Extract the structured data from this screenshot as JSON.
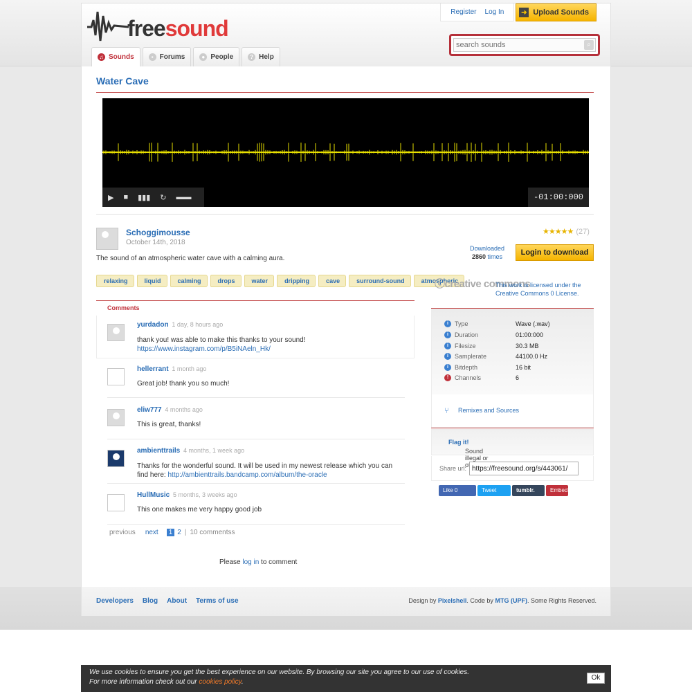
{
  "header": {
    "brand": {
      "free": "free",
      "sound": "sound"
    },
    "register": "Register",
    "login": "Log In",
    "upload": "Upload Sounds",
    "search_placeholder": "search sounds",
    "tabs": [
      {
        "label": "Sounds",
        "icon": "headphones-icon"
      },
      {
        "label": "Forums",
        "icon": "chat-icon"
      },
      {
        "label": "People",
        "icon": "people-icon"
      },
      {
        "label": "Help",
        "icon": "help-icon"
      }
    ]
  },
  "sound": {
    "title": "Water Cave",
    "timer": "-01:00:000",
    "user": "Schoggimousse",
    "date": "October 14th, 2018",
    "description": "The sound of an atmospheric water cave with a calming aura.",
    "rating_count": "(27)",
    "rating_stars": 5,
    "downloaded_label": "Downloaded",
    "downloaded_count": "2860",
    "downloaded_suffix": "times",
    "download_button": "Login to download",
    "tags": [
      "relaxing",
      "liquid",
      "calming",
      "drops",
      "water",
      "dripping",
      "cave",
      "surround-sound",
      "atmospheric"
    ],
    "license_logo": "creative commons",
    "license_line1": "This work is licensed under the",
    "license_line2": "Creative Commons 0 License."
  },
  "comments": {
    "heading": "Comments",
    "items": [
      {
        "user": "yurdadon",
        "ago": "1 day, 8 hours ago",
        "text": "thank you! was able to make this thanks to your sound!",
        "link": "https://www.instagram.com/p/B5iNAeln_Hk/"
      },
      {
        "user": "hellerrant",
        "ago": "1 month ago",
        "text": "Great job! thank you so much!",
        "link": ""
      },
      {
        "user": "eliw777",
        "ago": "4 months ago",
        "text": "This is great, thanks!",
        "link": ""
      },
      {
        "user": "ambienttrails",
        "ago": "4 months, 1 week ago",
        "text": "Thanks for the wonderful sound. It will be used in my newest release which you can",
        "text2": "find here:",
        "link": "http://ambienttrails.bandcamp.com/album/the-oracle"
      },
      {
        "user": "HullMusic",
        "ago": "5 months, 3 weeks ago",
        "text": "This one makes me very happy good job",
        "link": ""
      }
    ],
    "pager": {
      "previous": "previous",
      "next": "next",
      "current": "1",
      "page2": "2",
      "separator": "|",
      "total": "10 commentss"
    },
    "login_note": {
      "pre": "Please",
      "link": "log in",
      "post": "to comment"
    }
  },
  "info": [
    {
      "key": "Type",
      "value": "Wave (.wav)"
    },
    {
      "key": "Duration",
      "value": "01:00:000"
    },
    {
      "key": "Filesize",
      "value": "30.3 MB"
    },
    {
      "key": "Samplerate",
      "value": "44100.0 Hz"
    },
    {
      "key": "Bitdepth",
      "value": "16 bit"
    },
    {
      "key": "Channels",
      "value": "6"
    }
  ],
  "sidebar": {
    "remixes": "Remixes and Sources",
    "flag_text": "Sound illegal or offensive?",
    "flag_link": "Flag it!",
    "share_label": "Share url:",
    "share_url": "https://freesound.org/s/443061/",
    "social": {
      "like": "Like 0",
      "tweet": "Tweet",
      "tumblr": "tumblr.",
      "embed": "Embed"
    }
  },
  "footer": {
    "links": [
      "Developers",
      "Blog",
      "About",
      "Terms of use"
    ],
    "credits_pre": "Design by",
    "credits_design": "Pixelshell",
    "credits_mid": ". Code by",
    "credits_code": "MTG (UPF)",
    "credits_post": ". Some Rights Reserved."
  },
  "cookie": {
    "line1": "We use cookies to ensure you get the best experience on our website. By browsing our site you agree to our use of cookies.",
    "line2_pre": "For more information check out our",
    "line2_link": "cookies policy",
    "line2_post": ".",
    "ok": "Ok"
  },
  "colors": {
    "accent": "#c0303a",
    "link": "#2a6db5",
    "button": "#f5b400",
    "waveform": "#e8e000"
  }
}
